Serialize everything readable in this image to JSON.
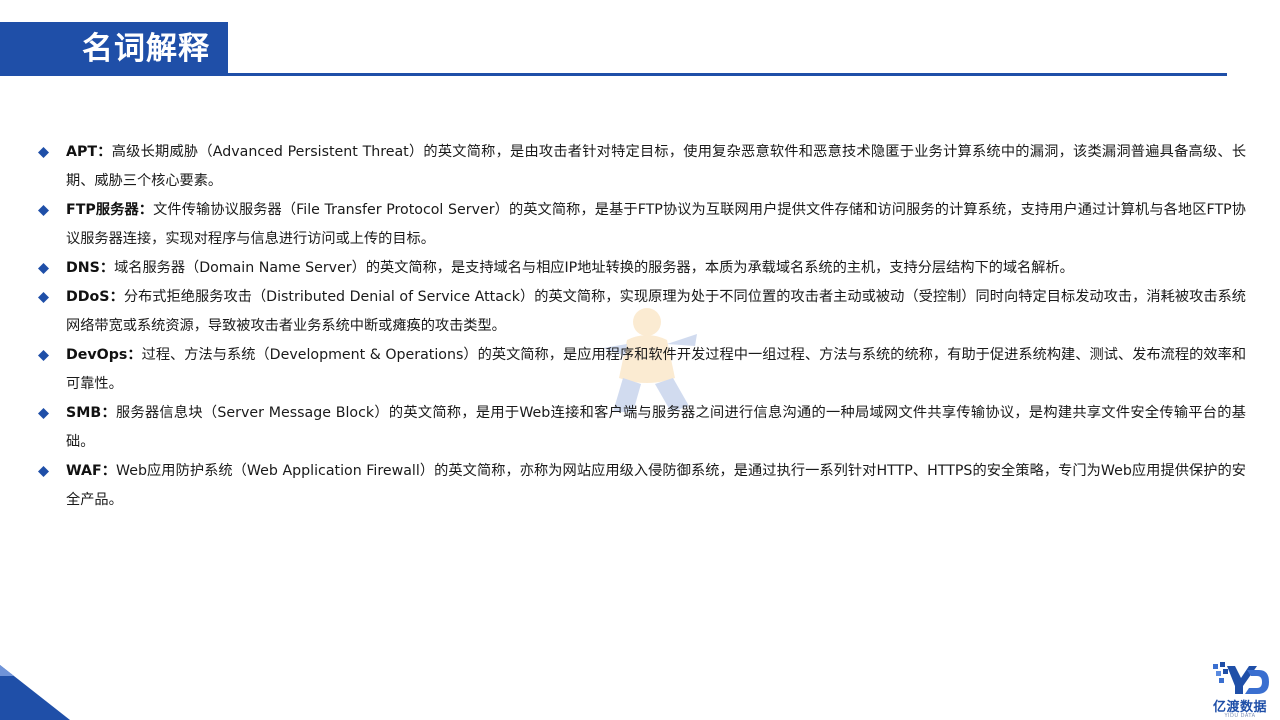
{
  "header": {
    "title": "名词解释"
  },
  "terms": [
    {
      "name": "APT：",
      "text": "高级长期威胁（Advanced Persistent Threat）的英文简称，是由攻击者针对特定目标，使用复杂恶意软件和恶意技术隐匿于业务计算系统中的漏洞，该类漏洞普遍具备高级、长期、威胁三个核心要素。"
    },
    {
      "name": "FTP服务器：",
      "text": "文件传输协议服务器（File Transfer Protocol Server）的英文简称，是基于FTP协议为互联网用户提供文件存储和访问服务的计算系统，支持用户通过计算机与各地区FTP协议服务器连接，实现对程序与信息进行访问或上传的目标。"
    },
    {
      "name": "DNS：",
      "text": "域名服务器（Domain Name Server）的英文简称，是支持域名与相应IP地址转换的服务器，本质为承载域名系统的主机，支持分层结构下的域名解析。"
    },
    {
      "name": "DDoS：",
      "text": "分布式拒绝服务攻击（Distributed Denial of Service Attack）的英文简称，实现原理为处于不同位置的攻击者主动或被动（受控制）同时向特定目标发动攻击，消耗被攻击系统网络带宽或系统资源，导致被攻击者业务系统中断或瘫痪的攻击类型。"
    },
    {
      "name": "DevOps：",
      "text": "过程、方法与系统（Development & Operations）的英文简称，是应用程序和软件开发过程中一组过程、方法与系统的统称，有助于促进系统构建、测试、发布流程的效率和可靠性。"
    },
    {
      "name": "SMB：",
      "text": "服务器信息块（Server Message Block）的英文简称，是用于Web连接和客户端与服务器之间进行信息沟通的一种局域网文件共享传输协议，是构建共享文件安全传输平台的基础。"
    },
    {
      "name": "WAF：",
      "text": "Web应用防护系统（Web Application Firewall）的英文简称，亦称为网站应用级入侵防御系统，是通过执行一系列针对HTTP、HTTPS的安全策略，专门为Web应用提供保护的安全产品。"
    }
  ],
  "logo": {
    "cn": "亿渡数据",
    "en": "YIDU DATA"
  },
  "colors": {
    "brand": "#1f4fa8",
    "text": "#1a1a1a",
    "bullet": "#1f4fa8"
  }
}
